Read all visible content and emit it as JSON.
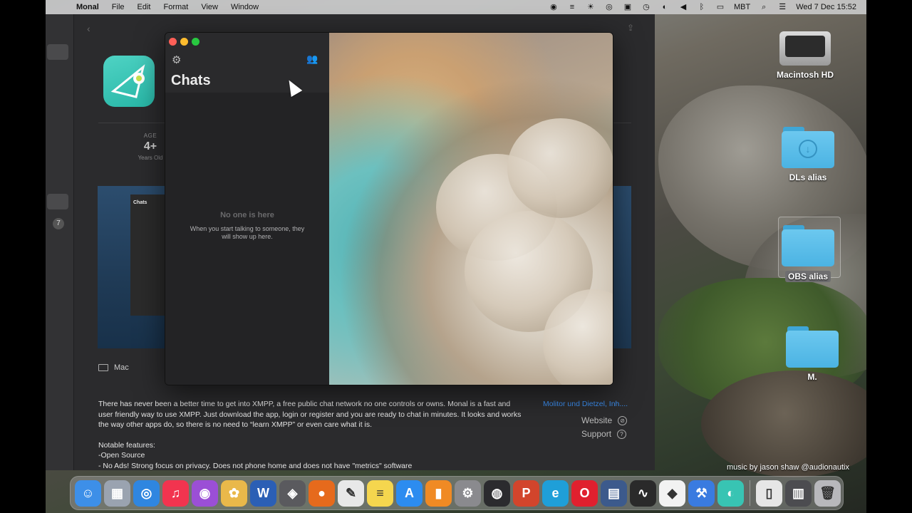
{
  "menubar": {
    "app_name": "Monal",
    "items": [
      "File",
      "Edit",
      "Format",
      "View",
      "Window"
    ],
    "input_source": "MBT",
    "clock": "Wed 7 Dec  15:52"
  },
  "appstore": {
    "age_label": "AGE",
    "age_value": "4+",
    "age_sub": "Years Old",
    "sidebar_badge": "7",
    "screenshot_title": "Chats",
    "platform": "Mac",
    "description": [
      "There has never been a better time to get into XMPP, a free public chat network no one controls or owns. Monal is a fast and user friendly way to use XMPP. Just download the app,  login or register and you are ready to chat in minutes. It looks and works the way other apps do, so there is no need to “learn XMPP” or even care what it is.",
      "Notable features:",
      "-Open Source",
      "- No Ads! Strong focus on privacy. Does not phone home and does not have \"metrics\" software"
    ],
    "developer": "Molitor und Dietzel, Inh....",
    "website": "Website",
    "support": "Support"
  },
  "monal": {
    "title": "Chats",
    "empty_title": "No one is here",
    "empty_subtitle": "When you start talking to someone, they will show up here."
  },
  "desktop": {
    "icons": [
      {
        "label": "Macintosh HD"
      },
      {
        "label": "DLs alias"
      },
      {
        "label": "OBS alias"
      },
      {
        "label": "M."
      }
    ],
    "credit": "music by jason shaw @audionautix"
  },
  "dock": {
    "apps": [
      {
        "name": "finder-icon",
        "color": "#3d8fe8",
        "glyph": "☺"
      },
      {
        "name": "launchpad-icon",
        "color": "#9aa3b0",
        "glyph": "▦"
      },
      {
        "name": "safari-icon",
        "color": "#2f86e0",
        "glyph": "◎"
      },
      {
        "name": "music-icon",
        "color": "#f2344f",
        "glyph": "♫"
      },
      {
        "name": "podcasts-icon",
        "color": "#9b4fd6",
        "glyph": "◉"
      },
      {
        "name": "photos-icon",
        "color": "#e9b84a",
        "glyph": "✿"
      },
      {
        "name": "word-icon",
        "color": "#2b5fb5",
        "glyph": "W"
      },
      {
        "name": "davinci-icon",
        "color": "#5a5a5e",
        "glyph": "◈"
      },
      {
        "name": "firefox-icon",
        "color": "#e66a1c",
        "glyph": "●"
      },
      {
        "name": "textedit-icon",
        "color": "#e8e8e8",
        "glyph": "✎"
      },
      {
        "name": "notes-icon",
        "color": "#f5d64e",
        "glyph": "≡"
      },
      {
        "name": "app-store-icon",
        "color": "#2c8cf0",
        "glyph": "A"
      },
      {
        "name": "books-icon",
        "color": "#f08a24",
        "glyph": "▮"
      },
      {
        "name": "system-preferences-icon",
        "color": "#8a8a8e",
        "glyph": "⚙"
      },
      {
        "name": "obs-icon",
        "color": "#2b2b2e",
        "glyph": "◍"
      },
      {
        "name": "powerpoint-icon",
        "color": "#d2452c",
        "glyph": "P"
      },
      {
        "name": "edge-icon",
        "color": "#1f9fd8",
        "glyph": "e"
      },
      {
        "name": "opera-icon",
        "color": "#e0202e",
        "glyph": "O"
      },
      {
        "name": "screen-recorder-icon",
        "color": "#3c5a8c",
        "glyph": "▤"
      },
      {
        "name": "activity-monitor-icon",
        "color": "#2a2a2a",
        "glyph": "∿"
      },
      {
        "name": "stacks-icon",
        "color": "#f2f2f2",
        "glyph": "◆"
      },
      {
        "name": "xcode-icon",
        "color": "#3a7be0",
        "glyph": "⚒"
      },
      {
        "name": "monal-icon",
        "color": "#38c4b3",
        "glyph": "◐"
      }
    ],
    "others": [
      {
        "name": "document-icon",
        "color": "#e6e6e6",
        "glyph": "▯"
      },
      {
        "name": "downloads-stack-icon",
        "color": "#4c4c50",
        "glyph": "▥"
      },
      {
        "name": "trash-icon",
        "color": "#b8b8bc",
        "glyph": "🗑"
      }
    ]
  }
}
